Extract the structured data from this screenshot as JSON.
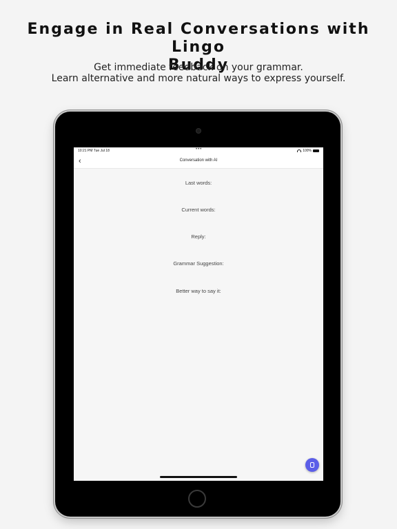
{
  "promo": {
    "headline_line1": "Engage in Real Conversations with Lingo",
    "headline_line2": "Buddy",
    "subline_line1": "Get immediate feedback on your grammar.",
    "subline_line2": "Learn alternative and more natural ways to express yourself."
  },
  "statusbar": {
    "time": "10:21 PM   Tue Jul 18",
    "dots": "•••",
    "battery": "100%"
  },
  "navbar": {
    "back_icon": "chevron-left-icon",
    "back_glyph": "‹",
    "title": "Conversation with AI"
  },
  "fields": [
    {
      "label": "Last words:"
    },
    {
      "label": "Current words:"
    },
    {
      "label": "Reply:"
    },
    {
      "label": "Grammar Suggestion:"
    },
    {
      "label": "Better way to say it:"
    }
  ],
  "mic_button": {
    "icon": "microphone-icon",
    "color": "#5b5ee8"
  }
}
